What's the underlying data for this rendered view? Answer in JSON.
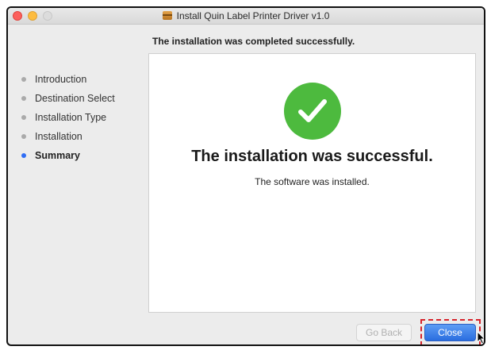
{
  "window": {
    "title": "Install Quin Label Printer Driver v1.0",
    "title_icon": "package-icon"
  },
  "header": {
    "subtitle": "The installation was completed successfully."
  },
  "sidebar": {
    "steps": [
      {
        "label": "Introduction",
        "active": false
      },
      {
        "label": "Destination Select",
        "active": false
      },
      {
        "label": "Installation Type",
        "active": false
      },
      {
        "label": "Installation",
        "active": false
      },
      {
        "label": "Summary",
        "active": true
      }
    ]
  },
  "main": {
    "icon": "success-check-icon",
    "headline": "The installation was successful.",
    "detail": "The software was installed."
  },
  "footer": {
    "back_label": "Go Back",
    "close_label": "Close"
  },
  "colors": {
    "success": "#4dba3e",
    "accent": "#2f6df5",
    "highlight": "#d6232b"
  }
}
